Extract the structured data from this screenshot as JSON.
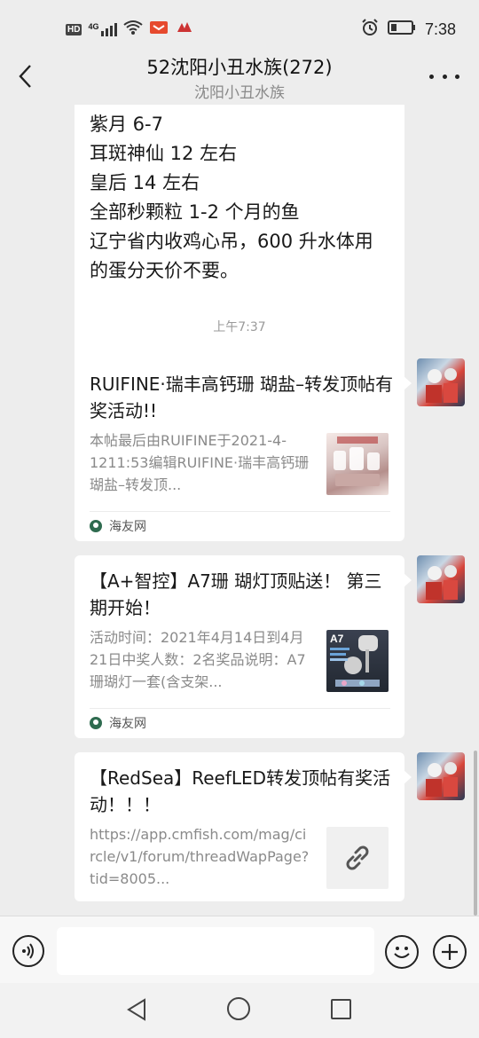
{
  "status_bar": {
    "hd_label": "HD",
    "network_label": "4G",
    "time": "7:38"
  },
  "header": {
    "title": "52沈阳小丑水族(272)",
    "subtitle": "沈阳小丑水族"
  },
  "messages": {
    "text_bubble": {
      "lines": [
        "紫月 6-7",
        "耳斑神仙 12 左右",
        "皇后 14 左右",
        "全部秒颗粒 1-2 个月的鱼",
        "辽宁省内收鸡心吊，600 升水体用",
        "的蛋分天价不要。"
      ]
    },
    "timestamp": "上午7:37",
    "cards": [
      {
        "title": "RUIFINE·瑞丰高钙珊 瑚盐–转发顶帖有奖活动!!",
        "description": "本帖最后由RUIFINE于2021-4-1211:53编辑RUIFINE·瑞丰高钙珊瑚盐–转发顶...",
        "source": "海友网",
        "thumb_icon": "product-photo-thumb"
      },
      {
        "title": "【A+智控】A7珊 瑚灯顶贴送！ 第三期开始！",
        "description": "活动时间：2021年4月14日到4月21日中奖人数：2名奖品说明：A7珊瑚灯一套(含支架...",
        "source": "海友网",
        "thumb_icon": "a7-lamp-thumb",
        "thumb_text": "A7"
      },
      {
        "title": "【RedSea】ReefLED转发顶帖有奖活动！！！",
        "description": "https://app.cmfish.com/mag/circle/v1/forum/threadWapPage?tid=8005...",
        "thumb_icon": "link-icon"
      }
    ]
  },
  "input_bar": {
    "placeholder": ""
  },
  "colors": {
    "chat_background": "#ededed",
    "bubble": "#ffffff",
    "secondary_text": "#8a8a8a"
  }
}
